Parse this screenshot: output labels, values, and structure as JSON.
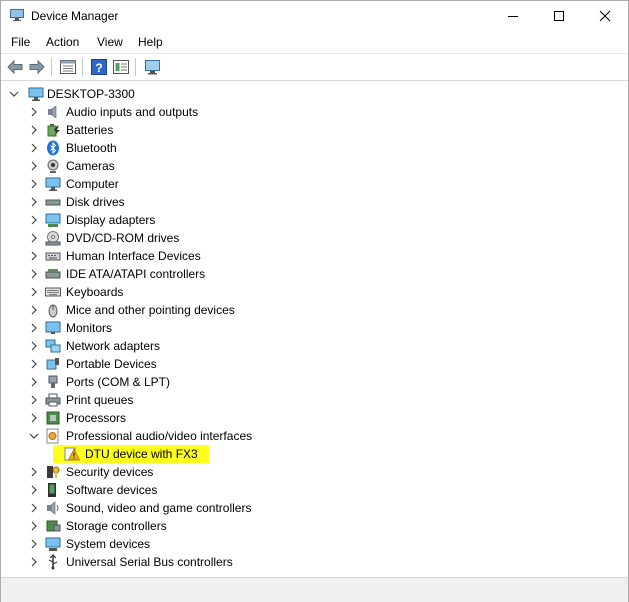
{
  "window": {
    "title": "Device Manager",
    "title_icon": "device-manager-icon"
  },
  "menu": [
    "File",
    "Action",
    "View",
    "Help"
  ],
  "toolbar": {
    "buttons": [
      "back-arrow-icon",
      "forward-arrow-icon",
      "properties-grid-icon",
      "help-icon",
      "details-icon",
      "monitor-scan-icon"
    ]
  },
  "tree": {
    "root": "DESKTOP-3300",
    "items": [
      "Audio inputs and outputs",
      "Batteries",
      "Bluetooth",
      "Cameras",
      "Computer",
      "Disk drives",
      "Display adapters",
      "DVD/CD-ROM drives",
      "Human Interface Devices",
      "IDE ATA/ATAPI controllers",
      "Keyboards",
      "Mice and other pointing devices",
      "Monitors",
      "Network adapters",
      "Portable Devices",
      "Ports (COM & LPT)",
      "Print queues",
      "Processors",
      "Professional audio/video interfaces",
      "Security devices",
      "Software devices",
      "Sound, video and game controllers",
      "Storage controllers",
      "System devices",
      "Universal Serial Bus controllers"
    ],
    "expanded_child": "DTU device with FX3"
  },
  "colors": {
    "highlight": "#ffff1e",
    "bluetooth": "#1e73d6",
    "warning": "#f2b600"
  }
}
